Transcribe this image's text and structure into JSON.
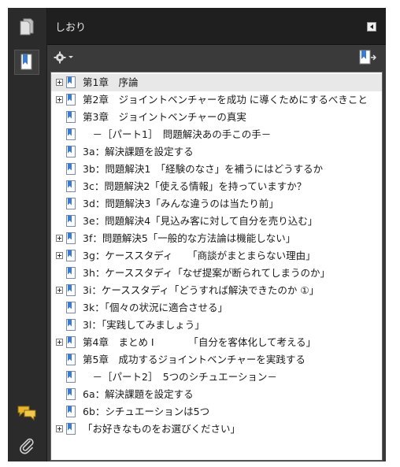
{
  "panel": {
    "title": "しおり"
  },
  "icons": {
    "pages": "pages-icon",
    "bookmarks": "bookmarks-icon",
    "comments": "comments-icon",
    "attachments": "paperclip-icon",
    "options": "gear-icon",
    "collapse": "triangle-left-icon",
    "new_bookmark": "new-bookmark-icon"
  },
  "colors": {
    "rail": "#2b2b2b",
    "header": "#1f1f1f",
    "icon_blue": "#3a7bd5",
    "selected_row": "#e8e8e8"
  },
  "bookmarks": [
    {
      "label": "第1章　序論",
      "expandable": true,
      "selected": true
    },
    {
      "label": "第2章　ジョイントベンチャーを成功 に導くためにするべきこと",
      "expandable": true
    },
    {
      "label": "第3章　ジョイントベンチャーの真実",
      "expandable": false
    },
    {
      "label": "　－［パート1］　問題解決あの手この手－",
      "expandable": false
    },
    {
      "label": "3a：解決課題を設定する",
      "expandable": false
    },
    {
      "label": "3b：問題解決1　「経験のなさ」を補うにはどうするか",
      "expandable": false
    },
    {
      "label": "3c：問題解決2「使える情報」を持っていますか？",
      "expandable": false
    },
    {
      "label": "3d：問題解決3「みんな違うのは当たり前」",
      "expandable": false
    },
    {
      "label": "3e：問題解決4「見込み客に対して自分を売り込む」",
      "expandable": false
    },
    {
      "label": "3f：問題解決5「一般的な方法論は機能しない」",
      "expandable": true
    },
    {
      "label": "3g：ケーススタディ　　「商談がまとまらない理由」",
      "expandable": true
    },
    {
      "label": "3h：ケーススタディ「なぜ提案が断られてしまうのか」",
      "expandable": false
    },
    {
      "label": "3i：ケーススタディ「どうすれば解決できたのか ①」",
      "expandable": true
    },
    {
      "label": "3k：「個々の状況に適合させる」",
      "expandable": false
    },
    {
      "label": "3l：「実践してみましょう」",
      "expandable": false
    },
    {
      "label": "第4章　まとめ Ⅰ　　　　「自分を客体化して考える」",
      "expandable": true
    },
    {
      "label": "第5章　成功するジョイントベンチャーを実践する",
      "expandable": false
    },
    {
      "label": "　－［パート2］　5つのシチュエーション－",
      "expandable": false
    },
    {
      "label": "6a：解決課題を設定する",
      "expandable": false
    },
    {
      "label": "6b：シチュエーションは5つ",
      "expandable": false
    },
    {
      "label": "「お好きなものをお選びください」",
      "expandable": true
    }
  ]
}
